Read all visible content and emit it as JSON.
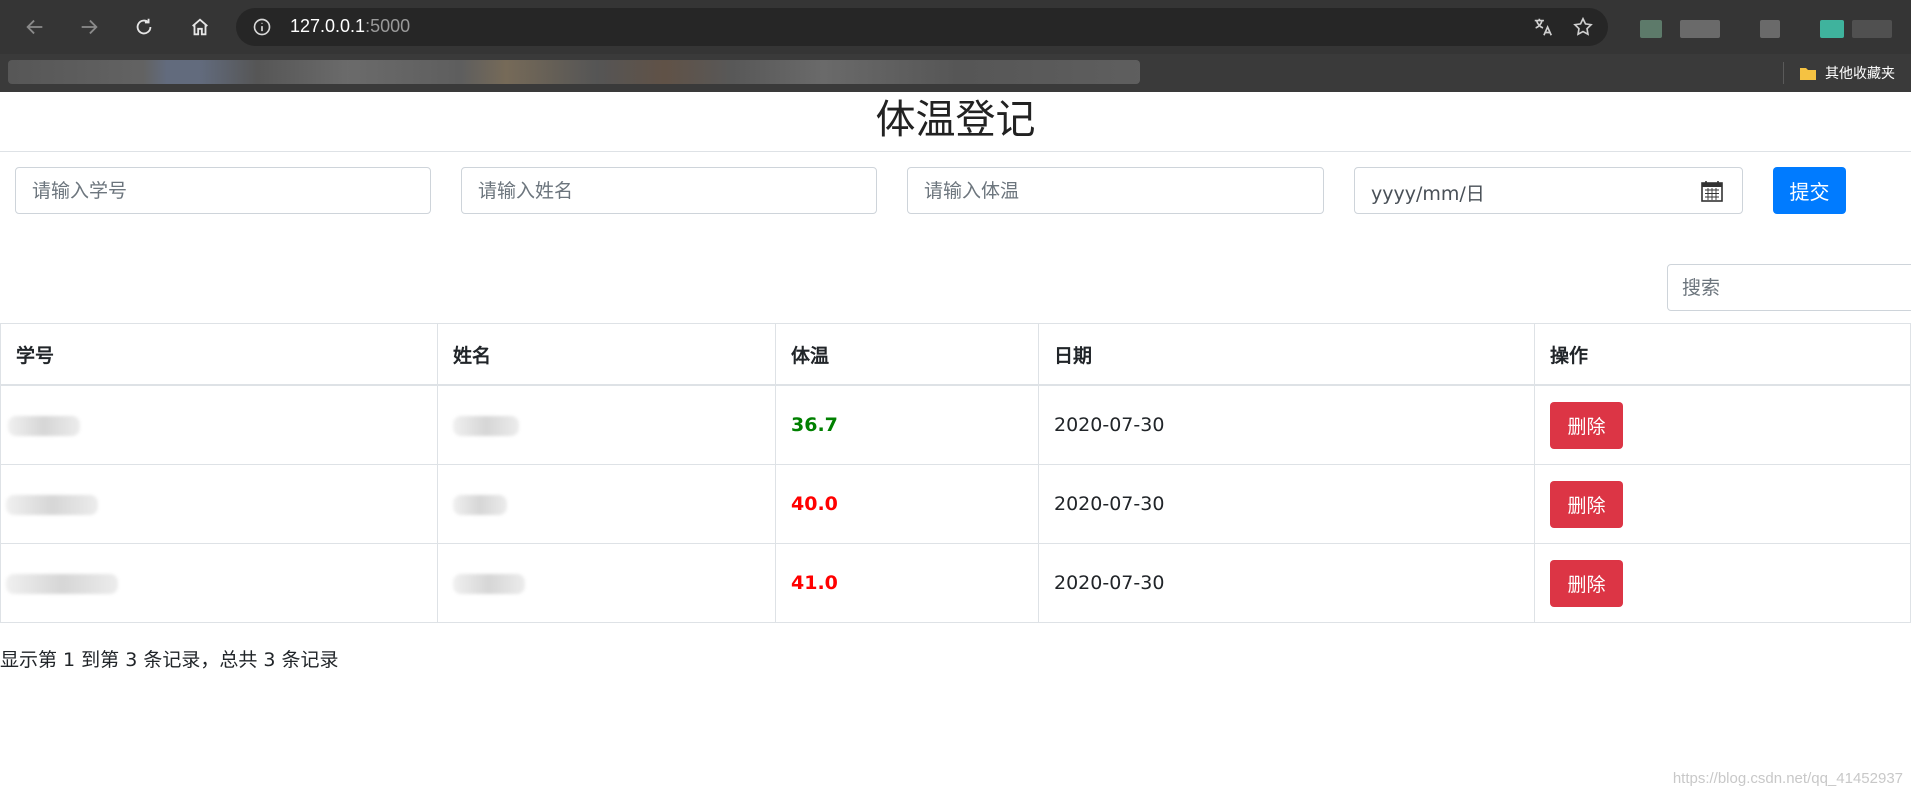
{
  "browser": {
    "url_host": "127.0.0.1",
    "url_port": ":5000",
    "bookmarks_folder": "其他收藏夹"
  },
  "page": {
    "title": "体温登记"
  },
  "form": {
    "student_id_placeholder": "请输入学号",
    "name_placeholder": "请输入姓名",
    "temperature_placeholder": "请输入体温",
    "date_placeholder": "yyyy/mm/日",
    "submit_label": "提交"
  },
  "search": {
    "placeholder": "搜索"
  },
  "table": {
    "headers": [
      "学号",
      "姓名",
      "体温",
      "日期",
      "操作"
    ],
    "rows": [
      {
        "temperature": "36.7",
        "date": "2020-07-30",
        "action": "删除"
      },
      {
        "temperature": "40.0",
        "date": "2020-07-30",
        "action": "删除"
      },
      {
        "temperature": "41.0",
        "date": "2020-07-30",
        "action": "删除"
      }
    ]
  },
  "pagination": {
    "summary": "显示第 1 到第 3 条记录，总共 3 条记录"
  },
  "watermark": "https://blog.csdn.net/qq_41452937",
  "colors": {
    "primary": "#007bff",
    "danger": "#dc3545",
    "temp_normal": "#008000",
    "temp_high": "#ff0000"
  }
}
